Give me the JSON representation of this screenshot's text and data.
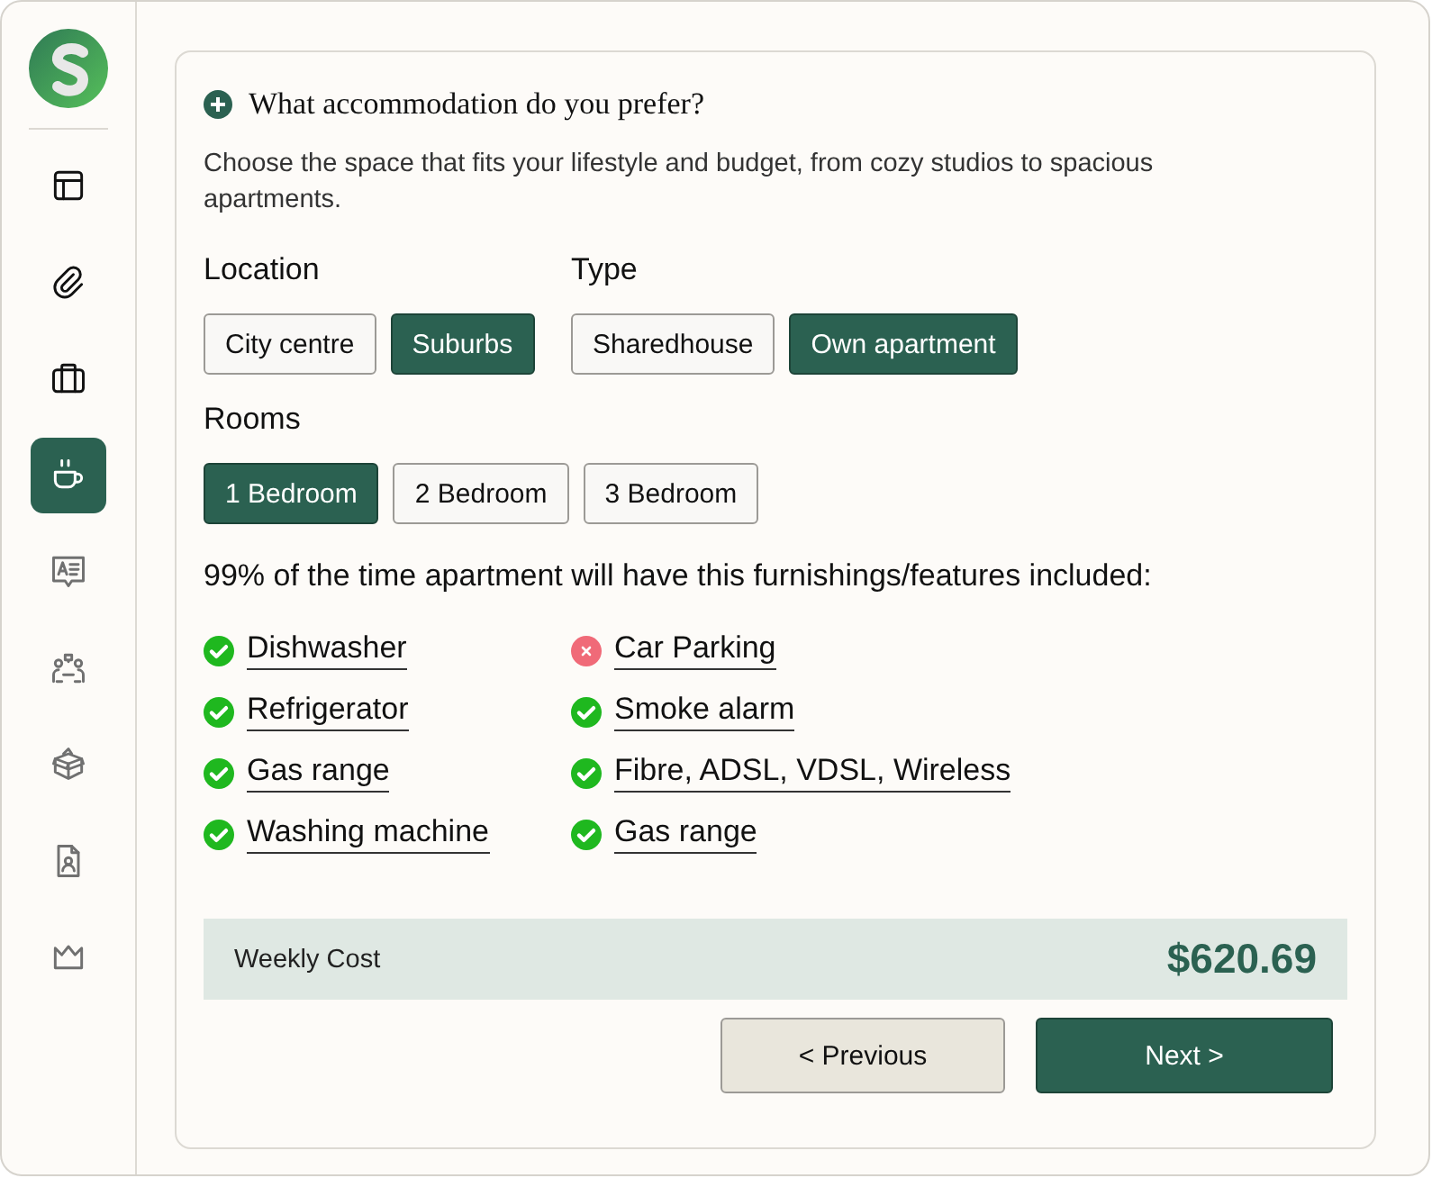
{
  "sidebar": {
    "items": [
      {
        "selected": false,
        "disabled": false
      },
      {
        "selected": false,
        "disabled": false
      },
      {
        "selected": false,
        "disabled": false
      },
      {
        "selected": true,
        "disabled": false
      },
      {
        "selected": false,
        "disabled": true
      },
      {
        "selected": false,
        "disabled": true
      },
      {
        "selected": false,
        "disabled": true
      },
      {
        "selected": false,
        "disabled": true
      },
      {
        "selected": false,
        "disabled": true
      }
    ]
  },
  "question": {
    "title": "What accommodation do you prefer?",
    "description": "Choose the space that fits your lifestyle and budget, from cozy studios to spacious apartments."
  },
  "filter_rows": [
    [
      {
        "label": "Location",
        "options": [
          {
            "label": "City centre",
            "selected": false
          },
          {
            "label": "Suburbs",
            "selected": true
          }
        ]
      },
      {
        "label": "Type",
        "options": [
          {
            "label": "Sharedhouse",
            "selected": false
          },
          {
            "label": "Own apartment",
            "selected": true
          }
        ]
      }
    ],
    [
      {
        "label": "Rooms",
        "options": [
          {
            "label": "1 Bedroom",
            "selected": true
          },
          {
            "label": "2 Bedroom",
            "selected": false
          },
          {
            "label": "3 Bedroom",
            "selected": false
          }
        ]
      }
    ]
  ],
  "features_heading": "99% of the time apartment will have this furnishings/features included:",
  "feature_columns": [
    [
      {
        "label": "Dishwasher",
        "included": true
      },
      {
        "label": "Refrigerator",
        "included": true
      },
      {
        "label": "Gas range",
        "included": true
      },
      {
        "label": "Washing machine",
        "included": true
      }
    ],
    [
      {
        "label": "Car Parking",
        "included": false
      },
      {
        "label": "Smoke alarm",
        "included": true
      },
      {
        "label": "Fibre, ADSL, VDSL, Wireless",
        "included": true
      },
      {
        "label": "Gas range",
        "included": true
      }
    ]
  ],
  "cost": {
    "label": "Weekly Cost",
    "value": "$620.69"
  },
  "buttons": [
    {
      "label": "< Previous",
      "kind": "secondary"
    },
    {
      "label": "Next >",
      "kind": "primary"
    }
  ]
}
